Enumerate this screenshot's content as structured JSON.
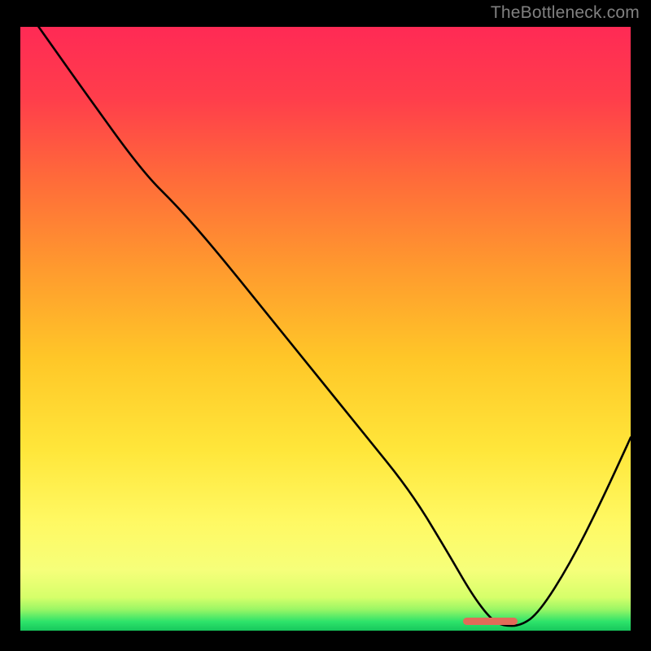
{
  "watermark": "TheBottleneck.com",
  "colors": {
    "background": "#000000",
    "watermark": "#808080",
    "line": "#000000",
    "marker": "#e26b58",
    "gradient_stops": [
      {
        "offset": 0.0,
        "color": "#ff2a55"
      },
      {
        "offset": 0.12,
        "color": "#ff3e4b"
      },
      {
        "offset": 0.25,
        "color": "#ff6a3a"
      },
      {
        "offset": 0.4,
        "color": "#ff9a2e"
      },
      {
        "offset": 0.55,
        "color": "#ffc728"
      },
      {
        "offset": 0.7,
        "color": "#ffe63a"
      },
      {
        "offset": 0.82,
        "color": "#fff963"
      },
      {
        "offset": 0.9,
        "color": "#f6ff7a"
      },
      {
        "offset": 0.945,
        "color": "#d6ff6a"
      },
      {
        "offset": 0.965,
        "color": "#99f665"
      },
      {
        "offset": 0.985,
        "color": "#2de36a"
      },
      {
        "offset": 1.0,
        "color": "#17c75c"
      }
    ]
  },
  "chart_data": {
    "type": "line",
    "title": "",
    "xlabel": "",
    "ylabel": "",
    "xlim": [
      0,
      100
    ],
    "ylim": [
      0,
      100
    ],
    "grid": false,
    "legend": false,
    "x": [
      3,
      10,
      20,
      26,
      32,
      40,
      48,
      56,
      64,
      70,
      74,
      77,
      79,
      82,
      85,
      90,
      95,
      100
    ],
    "values": [
      100,
      90,
      76,
      70,
      63,
      53,
      43,
      33,
      23,
      13,
      6,
      2,
      0.8,
      0.8,
      3,
      11,
      21,
      32
    ],
    "note": "V-shaped curve; minimum near x≈79–82 where y≈0.8. Left descent has a slight knee around x≈24.",
    "optimal_marker": {
      "x": 77,
      "y": 1.5,
      "width_pct": 9
    }
  }
}
